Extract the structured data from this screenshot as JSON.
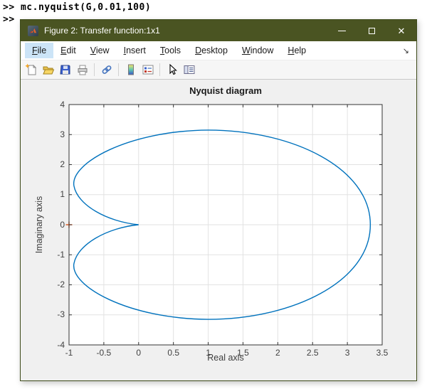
{
  "terminal": {
    "line1": ">> mc.nyquist(G,0.01,100)",
    "line2": ">>"
  },
  "window": {
    "title": "Figure 2: Transfer function:1x1",
    "titlebar_color": "#4a5422",
    "controls": [
      {
        "name": "minimize"
      },
      {
        "name": "maximize"
      },
      {
        "name": "close",
        "glyph": "✕"
      }
    ]
  },
  "menu": {
    "items": [
      {
        "label": "File",
        "highlighted": true
      },
      {
        "label": "Edit",
        "highlighted": false
      },
      {
        "label": "View",
        "highlighted": false
      },
      {
        "label": "Insert",
        "highlighted": false
      },
      {
        "label": "Tools",
        "highlighted": false
      },
      {
        "label": "Desktop",
        "highlighted": false
      },
      {
        "label": "Window",
        "highlighted": false
      },
      {
        "label": "Help",
        "highlighted": false
      }
    ],
    "dock_arrow_glyph": "↘"
  },
  "toolbar": {
    "buttons": [
      "new-figure",
      "open-file",
      "save-figure",
      "print-figure",
      "link-plot",
      "insert-colorbar",
      "insert-legend",
      "edit-plot-arrow",
      "property-inspector"
    ]
  },
  "chart_data": {
    "type": "line",
    "title": "Nyquist diagram",
    "xlabel": "Real axis",
    "ylabel": "Imaginary axis",
    "xlim": [
      -1,
      3.5
    ],
    "ylim": [
      -4,
      4
    ],
    "x_ticks": [
      -1,
      -0.5,
      0,
      0.5,
      1,
      1.5,
      2,
      2.5,
      3,
      3.5
    ],
    "x_tick_labels": [
      "-1",
      "-0.5",
      "0",
      "0.5",
      "1",
      "1.5",
      "2",
      "2.5",
      "3",
      "3.5"
    ],
    "y_ticks": [
      -4,
      -3,
      -2,
      -1,
      0,
      1,
      2,
      3,
      4
    ],
    "y_tick_labels": [
      "-4",
      "-3",
      "-2",
      "-1",
      "0",
      "1",
      "2",
      "3",
      "4"
    ],
    "grid": true,
    "grid_color": "#e2e2e2",
    "axis_color": "#333333",
    "plot_bg": "#ffffff",
    "series": [
      {
        "name": "nyquist-curve",
        "color": "#0072BD",
        "description": "Closed Nyquist contour: cusp at origin (0,0), left lobes reach (-0.93, +/-1.3), top/bottom extremes +/-3.15 near real=1, rightmost point (3.33, 0)",
        "path": {
          "start": [
            0,
            0
          ],
          "beziers": [
            [
              -0.45,
              0.1,
              -0.88,
              0.65,
              -0.93,
              1.3
            ],
            [
              -0.98,
              2.05,
              -0.15,
              3.13,
              1.0,
              3.15
            ],
            [
              2.2,
              3.15,
              3.33,
              1.9,
              3.33,
              0.0
            ],
            [
              3.33,
              -1.9,
              2.2,
              -3.15,
              1.0,
              -3.15
            ],
            [
              -0.15,
              -3.13,
              -0.98,
              -2.05,
              -0.93,
              -1.3
            ],
            [
              -0.88,
              -0.65,
              -0.45,
              -0.1,
              0.0,
              0.0
            ]
          ]
        }
      }
    ],
    "markers": [
      {
        "name": "critical-point",
        "x": -1,
        "y": 0,
        "shape": "+",
        "color": "#D95319"
      }
    ]
  }
}
